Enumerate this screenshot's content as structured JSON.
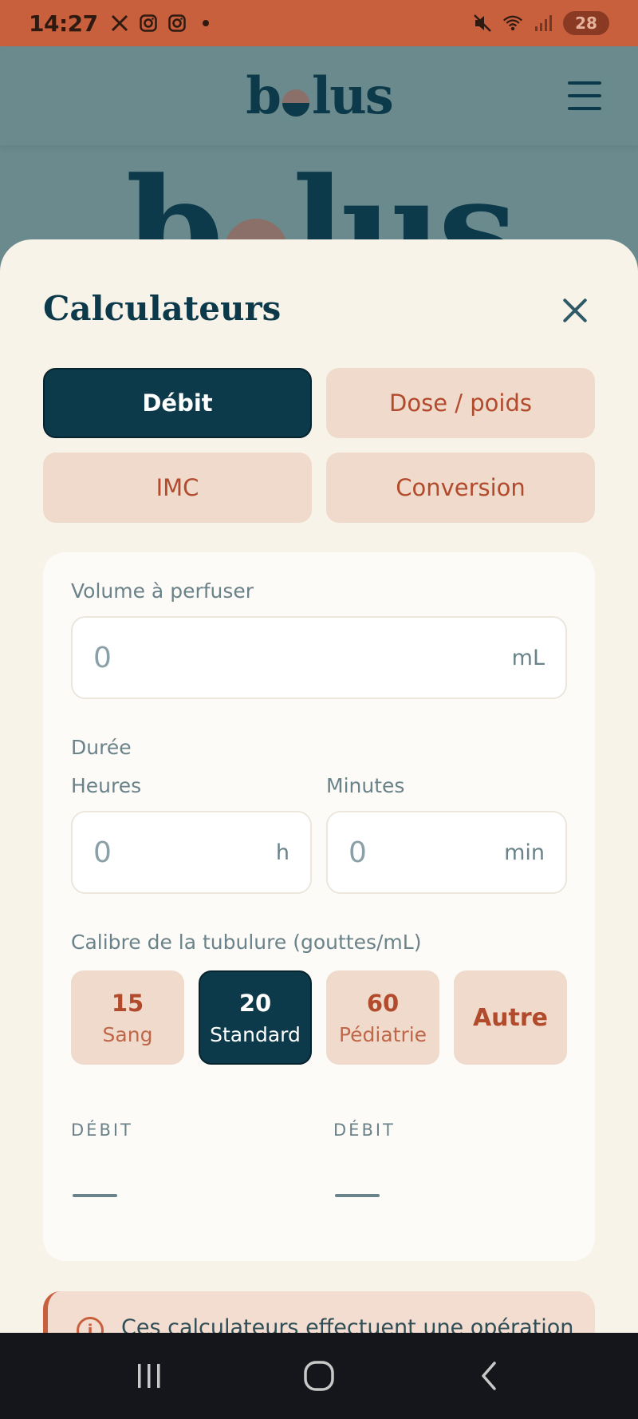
{
  "status_bar": {
    "time": "14:27",
    "left_icons": [
      "x-icon",
      "instagram-icon",
      "instagram-icon",
      "dot-icon"
    ],
    "battery": "28"
  },
  "header": {
    "logo": {
      "left": "b",
      "right": "lus"
    }
  },
  "hero": {
    "left": "b",
    "right": "lus"
  },
  "sheet": {
    "title": "Calculateurs",
    "tabs": [
      {
        "label": "Débit",
        "active": true
      },
      {
        "label": "Dose / poids",
        "active": false
      },
      {
        "label": "IMC",
        "active": false
      },
      {
        "label": "Conversion",
        "active": false
      }
    ]
  },
  "form": {
    "volume_label": "Volume à perfuser",
    "volume_value": "0",
    "volume_unit": "mL",
    "duree_label": "Durée",
    "heures_label": "Heures",
    "heures_value": "0",
    "heures_unit": "h",
    "minutes_label": "Minutes",
    "minutes_value": "0",
    "minutes_unit": "min",
    "calibre_label": "Calibre de la tubulure (gouttes/mL)",
    "calibres": [
      {
        "value": "15",
        "label": "Sang",
        "active": false
      },
      {
        "value": "20",
        "label": "Standard",
        "active": true
      },
      {
        "value": "60",
        "label": "Pédiatrie",
        "active": false
      },
      {
        "value": "Autre",
        "label": "",
        "active": false
      }
    ]
  },
  "results": {
    "left_label": "DÉBIT",
    "right_label": "DÉBIT"
  },
  "info": {
    "text": "Ces calculateurs effectuent une opération"
  },
  "colors": {
    "brand_dark": "#0c3a4a",
    "accent": "#c9603d",
    "tab_inactive_bg": "#efdacb",
    "sheet_bg": "#f8f3e9"
  }
}
